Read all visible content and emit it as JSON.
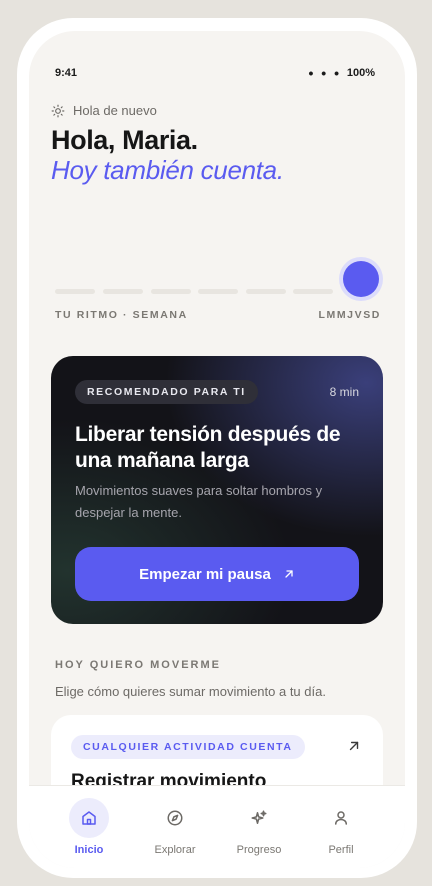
{
  "status": {
    "time": "9:41",
    "dots": "• • •",
    "battery": "100%"
  },
  "header": {
    "greeting": "Hola de nuevo",
    "title": "Hola, Maria.",
    "subtitle": "Hoy también cuenta."
  },
  "rhythm": {
    "label": "TU RITMO · SEMANA",
    "days": "LMMJVSD"
  },
  "recommended": {
    "badge": "RECOMENDADO PARA TI",
    "duration": "8 min",
    "title": "Liberar tensión después de una mañana larga",
    "description": "Movimientos suaves para soltar hombros y despejar la mente.",
    "cta": "Empezar mi pausa"
  },
  "section": {
    "title": "HOY QUIERO MOVERME",
    "description": "Elige cómo quieres sumar movimiento a tu día."
  },
  "activity": {
    "tag": "CUALQUIER ACTIVIDAD CUENTA",
    "title": "Registrar movimiento"
  },
  "tabs": [
    {
      "label": "Inicio",
      "icon": "home-icon"
    },
    {
      "label": "Explorar",
      "icon": "compass-icon"
    },
    {
      "label": "Progreso",
      "icon": "sparkles-icon"
    },
    {
      "label": "Perfil",
      "icon": "user-icon"
    }
  ],
  "colors": {
    "accent": "#5a5bf0",
    "background": "#f6f4f1",
    "card_dark": "#131318"
  }
}
